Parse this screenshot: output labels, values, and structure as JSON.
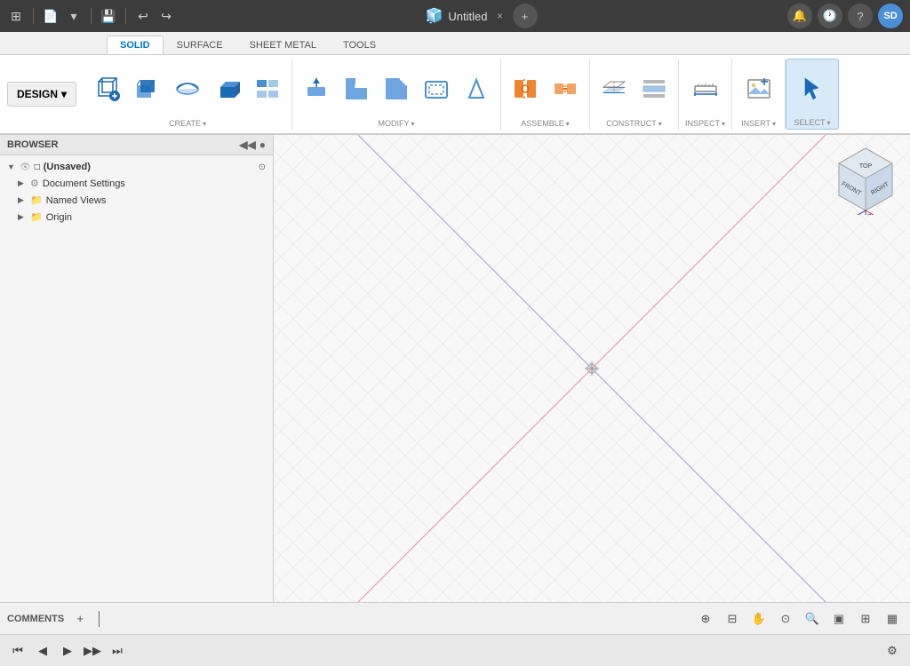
{
  "titlebar": {
    "title": "Untitled",
    "close_label": "×",
    "add_label": "+",
    "user_avatar": "SD"
  },
  "ribbon": {
    "tabs": [
      {
        "id": "solid",
        "label": "SOLID",
        "active": true
      },
      {
        "id": "surface",
        "label": "SURFACE"
      },
      {
        "id": "sheet_metal",
        "label": "SHEET METAL"
      },
      {
        "id": "tools",
        "label": "TOOLS"
      }
    ],
    "design_label": "DESIGN",
    "sections": [
      {
        "id": "create",
        "label": "CREATE",
        "has_arrow": true,
        "tools": [
          {
            "id": "new-component",
            "label": ""
          },
          {
            "id": "new-body",
            "label": ""
          },
          {
            "id": "extrude",
            "label": ""
          },
          {
            "id": "revolve",
            "label": ""
          },
          {
            "id": "box",
            "label": ""
          }
        ]
      },
      {
        "id": "modify",
        "label": "MODIFY",
        "has_arrow": true,
        "tools": [
          {
            "id": "press-pull",
            "label": ""
          },
          {
            "id": "fillet",
            "label": ""
          },
          {
            "id": "chamfer",
            "label": ""
          },
          {
            "id": "shell",
            "label": ""
          },
          {
            "id": "draft",
            "label": ""
          }
        ]
      },
      {
        "id": "assemble",
        "label": "ASSEMBLE",
        "has_arrow": true,
        "tools": [
          {
            "id": "joint",
            "label": ""
          },
          {
            "id": "rigid-group",
            "label": ""
          }
        ]
      },
      {
        "id": "construct",
        "label": "CONSTRUCT",
        "has_arrow": true,
        "tools": [
          {
            "id": "offset-plane",
            "label": ""
          },
          {
            "id": "midplane",
            "label": ""
          }
        ]
      },
      {
        "id": "inspect",
        "label": "INSPECT",
        "has_arrow": true,
        "tools": [
          {
            "id": "measure",
            "label": ""
          }
        ]
      },
      {
        "id": "insert",
        "label": "INSERT",
        "has_arrow": true,
        "tools": [
          {
            "id": "insert-image",
            "label": ""
          }
        ]
      },
      {
        "id": "select",
        "label": "SELECT",
        "has_arrow": true,
        "tools": [
          {
            "id": "select-tool",
            "label": ""
          }
        ]
      }
    ]
  },
  "browser": {
    "title": "BROWSER",
    "items": [
      {
        "id": "unsaved",
        "label": "(Unsaved)",
        "badge": true,
        "expanded": true,
        "indent": 0
      },
      {
        "id": "document-settings",
        "label": "Document Settings",
        "icon": "gear",
        "indent": 1
      },
      {
        "id": "named-views",
        "label": "Named Views",
        "icon": "folder",
        "indent": 1
      },
      {
        "id": "origin",
        "label": "Origin",
        "icon": "folder",
        "indent": 1
      }
    ]
  },
  "statusbar": {
    "label": "COMMENTS",
    "add_label": "+"
  },
  "timeline": {
    "buttons": [
      "⏮",
      "◀",
      "▶",
      "▶▶",
      "⏭"
    ]
  },
  "viewcube": {
    "front": "FRONT",
    "right": "RIGHT",
    "top": "TOP"
  }
}
